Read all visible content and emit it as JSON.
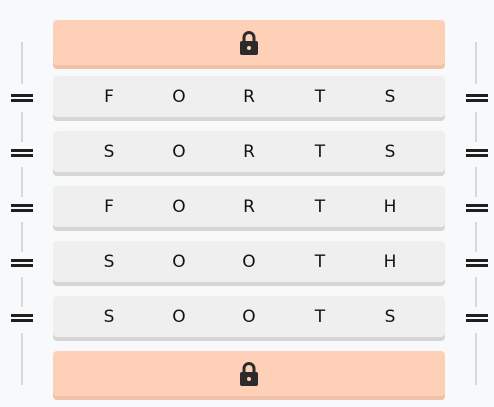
{
  "puzzle": {
    "top_lock": {
      "icon": "lock-icon"
    },
    "bottom_lock": {
      "icon": "lock-icon"
    },
    "rows": [
      {
        "word": "FORTS",
        "letters": [
          "F",
          "O",
          "R",
          "T",
          "S"
        ]
      },
      {
        "word": "SORTS",
        "letters": [
          "S",
          "O",
          "R",
          "T",
          "S"
        ]
      },
      {
        "word": "FORTH",
        "letters": [
          "F",
          "O",
          "R",
          "T",
          "H"
        ]
      },
      {
        "word": "SOOTH",
        "letters": [
          "S",
          "O",
          "O",
          "T",
          "H"
        ]
      },
      {
        "word": "SOOTS",
        "letters": [
          "S",
          "O",
          "O",
          "T",
          "S"
        ]
      }
    ]
  },
  "colors": {
    "lock_bar": "#ffd0b8",
    "row": "#efefef",
    "text": "#111111"
  }
}
